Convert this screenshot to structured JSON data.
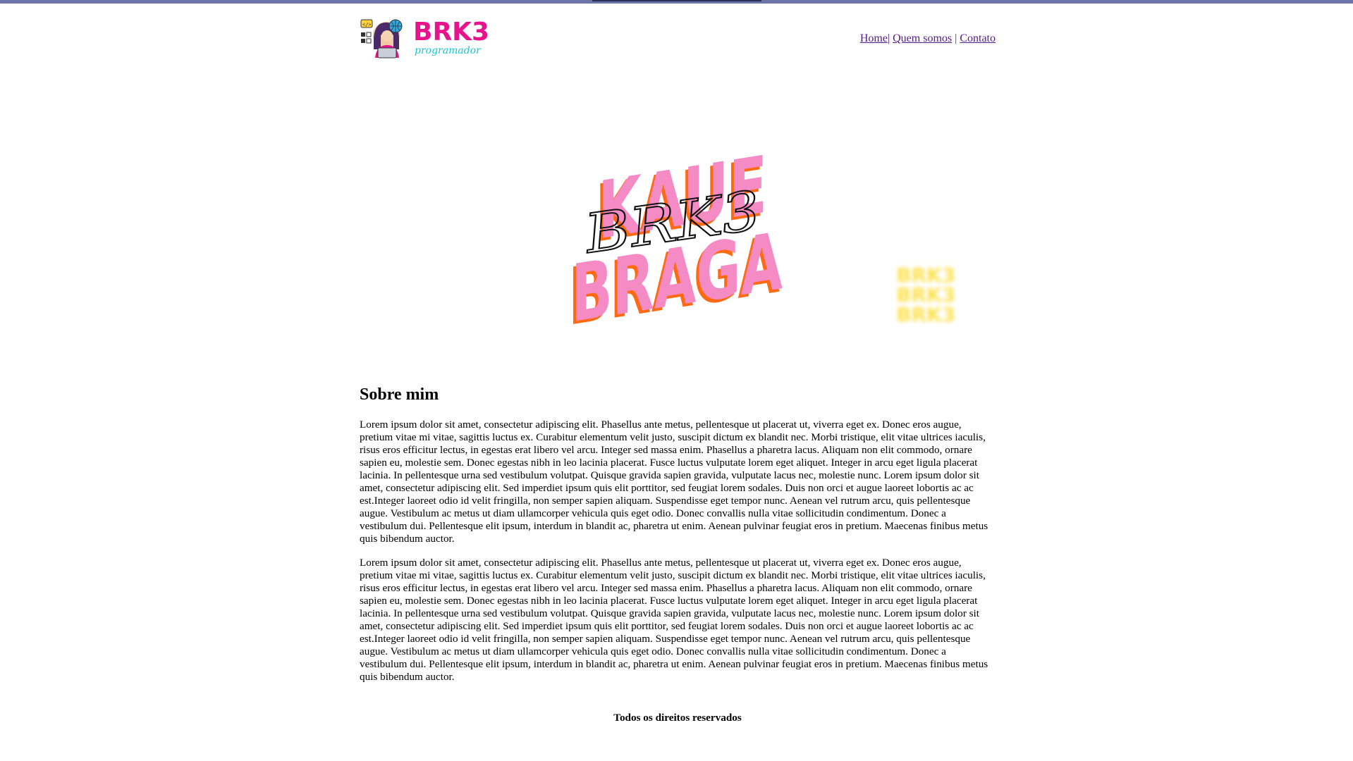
{
  "logo": {
    "brand": "BRK3",
    "tagline": "programador"
  },
  "nav": {
    "items": [
      "Home",
      "Quem somos",
      "Contato"
    ],
    "separator": "|"
  },
  "hero": {
    "line1": "KAUE",
    "line2": "BRAGA",
    "signature": "BRK3"
  },
  "deco": {
    "text": "BRK3"
  },
  "about": {
    "title": "Sobre mim",
    "paragraph1": "Lorem ipsum dolor sit amet, consectetur adipiscing elit. Phasellus ante metus, pellentesque ut placerat ut, viverra eget ex. Donec eros augue, pretium vitae mi vitae, sagittis luctus ex. Curabitur elementum velit justo, suscipit dictum ex blandit nec. Morbi tristique, elit vitae ultrices iaculis, risus eros efficitur lectus, in egestas erat libero vel arcu. Integer sed massa enim. Phasellus a pharetra lacus. Aliquam non elit commodo, ornare sapien eu, molestie sem. Donec egestas nibh in leo lacinia placerat. Fusce luctus vulputate lorem eget aliquet. Integer in arcu eget ligula placerat lacinia. In pellentesque urna sed vestibulum volutpat. Quisque gravida sapien gravida, vulputate lacus nec, molestie nunc. Lorem ipsum dolor sit amet, consectetur adipiscing elit. Sed imperdiet ipsum quis elit porttitor, sed feugiat lorem sodales. Duis non orci et augue laoreet lobortis ac ac est.Integer laoreet odio id velit fringilla, non semper sapien aliquam. Suspendisse eget tempor nunc. Aenean vel rutrum arcu, quis pellentesque augue. Vestibulum ac metus ut diam ullamcorper vehicula quis eget odio. Donec convallis nulla vitae sollicitudin condimentum. Donec a vestibulum dui. Pellentesque elit ipsum, interdum in blandit ac, pharetra ut enim. Aenean pulvinar feugiat eros in pretium. Maecenas finibus metus quis bibendum auctor.",
    "paragraph2": "Lorem ipsum dolor sit amet, consectetur adipiscing elit. Phasellus ante metus, pellentesque ut placerat ut, viverra eget ex. Donec eros augue, pretium vitae mi vitae, sagittis luctus ex. Curabitur elementum velit justo, suscipit dictum ex blandit nec. Morbi tristique, elit vitae ultrices iaculis, risus eros efficitur lectus, in egestas erat libero vel arcu. Integer sed massa enim. Phasellus a pharetra lacus. Aliquam non elit commodo, ornare sapien eu, molestie sem. Donec egestas nibh in leo lacinia placerat. Fusce luctus vulputate lorem eget aliquet. Integer in arcu eget ligula placerat lacinia. In pellentesque urna sed vestibulum volutpat. Quisque gravida sapien gravida, vulputate lacus nec, molestie nunc. Lorem ipsum dolor sit amet, consectetur adipiscing elit. Sed imperdiet ipsum quis elit porttitor, sed feugiat lorem sodales. Duis non orci et augue laoreet lobortis ac ac est.Integer laoreet odio id velit fringilla, non semper sapien aliquam. Suspendisse eget tempor nunc. Aenean vel rutrum arcu, quis pellentesque augue. Vestibulum ac metus ut diam ullamcorper vehicula quis eget odio. Donec convallis nulla vitae sollicitudin condimentum. Donec a vestibulum dui. Pellentesque elit ipsum, interdum in blandit ac, pharetra ut enim. Aenean pulvinar feugiat eros in pretium. Maecenas finibus metus quis bibendum auctor."
  },
  "footer": {
    "text": "Todos os direitos reservados"
  },
  "colors": {
    "top_bar": "#6b73a8",
    "link": "#551a8b",
    "logo_pink": "#e6138c",
    "logo_cyan": "#16c6d6",
    "hero_pink": "#f58bc4",
    "hero_orange": "#ff6a13",
    "deco_yellow": "#ffe14d"
  }
}
